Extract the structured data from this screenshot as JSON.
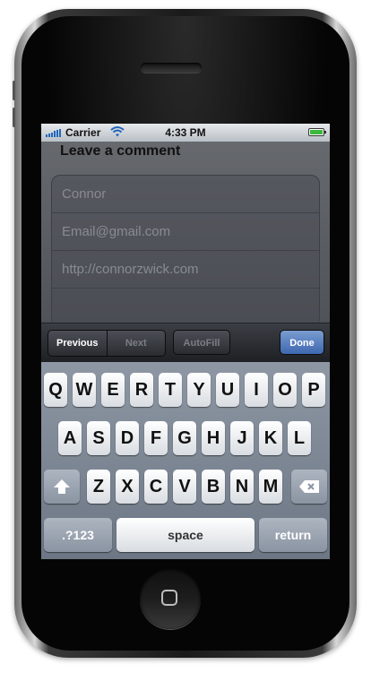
{
  "statusbar": {
    "carrier": "Carrier",
    "time": "4:33 PM",
    "battery_level": 1.0,
    "icons": [
      "signal-bars-icon",
      "wifi-icon",
      "battery-icon"
    ]
  },
  "form": {
    "heading": "Leave a comment",
    "name_placeholder": "Connor",
    "email_placeholder": "Email@gmail.com",
    "url_placeholder": "http://connorzwick.com",
    "comment_value": ""
  },
  "toolbar": {
    "previous_label": "Previous",
    "next_label": "Next",
    "autofill_label": "AutoFill",
    "done_label": "Done"
  },
  "keyboard": {
    "row1": [
      "Q",
      "W",
      "E",
      "R",
      "T",
      "Y",
      "U",
      "I",
      "O",
      "P"
    ],
    "row2": [
      "A",
      "S",
      "D",
      "F",
      "G",
      "H",
      "J",
      "K",
      "L"
    ],
    "row3": [
      "Z",
      "X",
      "C",
      "V",
      "B",
      "N",
      "M"
    ],
    "numbers_label": ".?123",
    "space_label": "space",
    "return_label": "return",
    "shift_icon": "shift-arrow-icon",
    "delete_icon": "backspace-icon"
  },
  "colors": {
    "done_accent": "#4a72b8",
    "battery_fill": "#3cb83c",
    "signal_blue": "#2266bb"
  }
}
